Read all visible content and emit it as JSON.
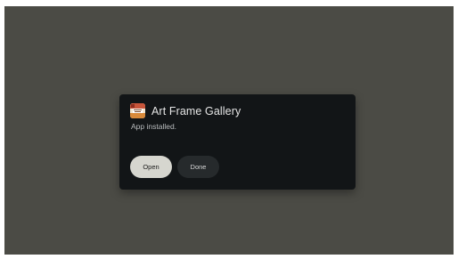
{
  "dialog": {
    "app_name": "Art Frame Gallery",
    "message": "App installed.",
    "open_label": "Open",
    "done_label": "Done"
  },
  "icons": {
    "app": "art-frame-gallery-app-icon"
  },
  "colors": {
    "backdrop": "#4b4b45",
    "dialog_bg": "#121517",
    "primary_button": "#d6d6cf",
    "secondary_button": "#262a2c"
  }
}
